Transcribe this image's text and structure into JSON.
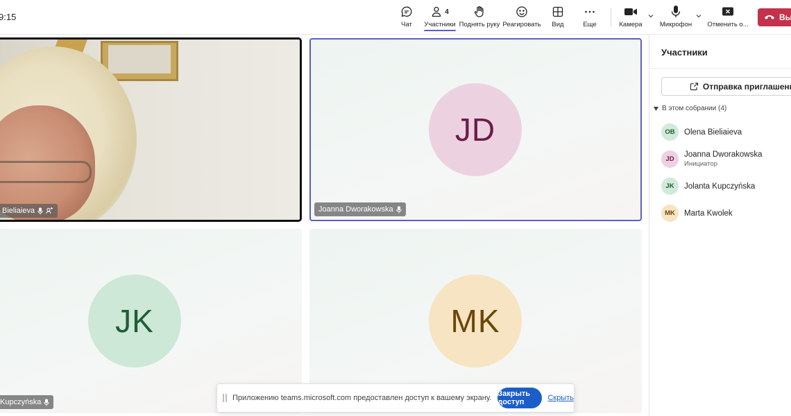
{
  "clock": "9:15",
  "toolbar": {
    "chat_label": "Чат",
    "people_label": "Участники",
    "people_count": "4",
    "raise_hand_label": "Поднять руку",
    "react_label": "Реагировать",
    "view_label": "Вид",
    "more_label": "Еще",
    "camera_label": "Камера",
    "mic_label": "Микрофон",
    "stop_share_label": "Отменить о...",
    "leave_label": "Вы",
    "leave_color": "#c4314b",
    "accent_color": "#5b5fc7"
  },
  "tiles": [
    {
      "name": "Bieliaieva",
      "initials": "",
      "type": "camera"
    },
    {
      "name": "Joanna Dworakowska",
      "initials": "JD",
      "avatar_bg": "#ecd2e0",
      "avatar_fg": "#6b1c4a",
      "speaking": true
    },
    {
      "name": "Kupczyńska",
      "initials": "JK",
      "avatar_bg": "#cde8d6",
      "avatar_fg": "#1f5d38"
    },
    {
      "name": "",
      "initials": "MK",
      "avatar_bg": "#f7e4c2",
      "avatar_fg": "#6b4609"
    }
  ],
  "share_bar": {
    "message": "Приложению teams.microsoft.com предоставлен доступ к вашему экрану.",
    "close_access_label": "Закрыть доступ",
    "hide_label": "Скрыть"
  },
  "panel": {
    "title": "Участники",
    "invite_label": "Отправка приглашения",
    "section_label": "В этом собрании (4)",
    "participants": [
      {
        "initials": "OB",
        "name": "Olena Bieliaieva",
        "role": "",
        "bg": "#d2ead9",
        "fg": "#1f5d38"
      },
      {
        "initials": "JD",
        "name": "Joanna Dworakowska",
        "role": "Инициатор",
        "bg": "#ecd2e0",
        "fg": "#6b1c4a"
      },
      {
        "initials": "JK",
        "name": "Jolanta Kupczyńska",
        "role": "",
        "bg": "#d2ead9",
        "fg": "#1f5d38"
      },
      {
        "initials": "MK",
        "name": "Marta Kwolek",
        "role": "",
        "bg": "#f7e4c2",
        "fg": "#6b4609"
      }
    ]
  }
}
